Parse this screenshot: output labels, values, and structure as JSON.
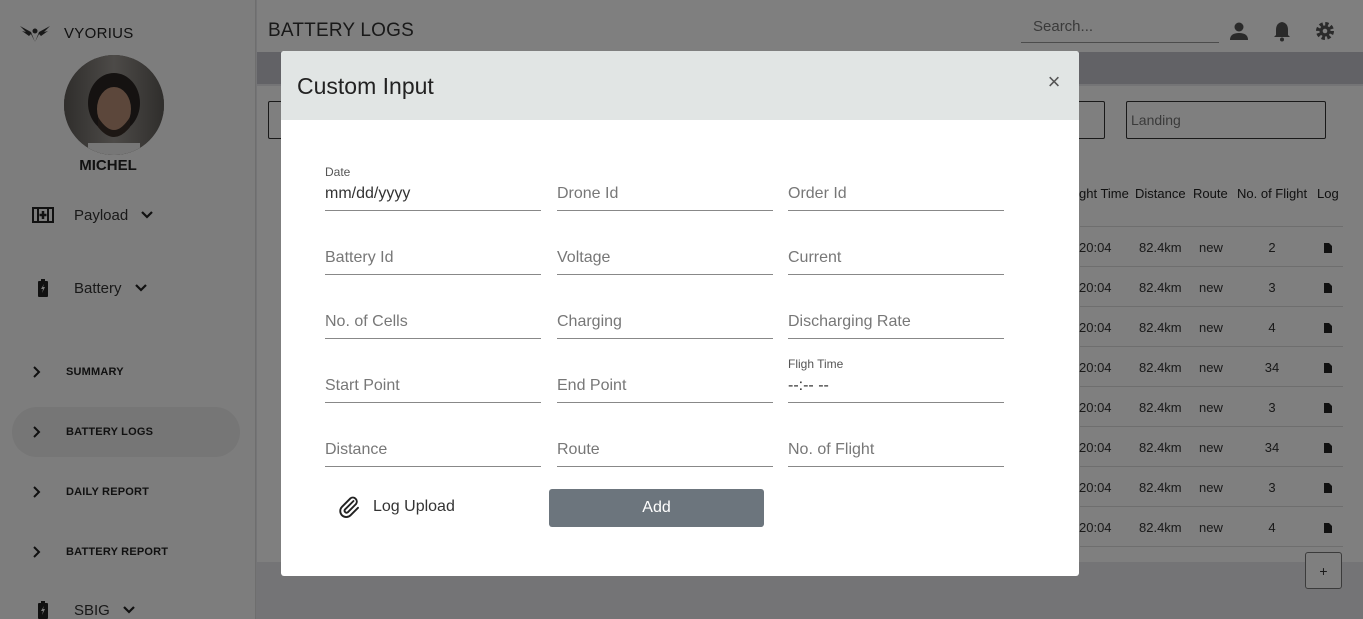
{
  "brand": {
    "name": "VYORIUS"
  },
  "user": {
    "name": "MICHEL"
  },
  "sidebar": {
    "dropdowns": [
      {
        "label": "Payload",
        "icon": "payload-icon"
      },
      {
        "label": "Battery",
        "icon": "battery-icon"
      },
      {
        "label": "SBIG",
        "icon": "battery-icon"
      }
    ],
    "nav": [
      {
        "label": "SUMMARY",
        "active": false
      },
      {
        "label": "BATTERY LOGS",
        "active": true
      },
      {
        "label": "DAILY REPORT",
        "active": false
      },
      {
        "label": "BATTERY REPORT",
        "active": false
      }
    ]
  },
  "topbar": {
    "title": "BATTERY LOGS",
    "search_placeholder": "Search..."
  },
  "filters": {
    "landing_placeholder": "Landing"
  },
  "table": {
    "headers": [
      "ght Time",
      "Distance",
      "Route",
      "No. of Flight",
      "Log"
    ],
    "rows": [
      {
        "time": "20:04",
        "distance": "82.4km",
        "route": "new",
        "flights": "2"
      },
      {
        "time": "20:04",
        "distance": "82.4km",
        "route": "new",
        "flights": "3"
      },
      {
        "time": "20:04",
        "distance": "82.4km",
        "route": "new",
        "flights": "4"
      },
      {
        "time": "20:04",
        "distance": "82.4km",
        "route": "new",
        "flights": "34"
      },
      {
        "time": "20:04",
        "distance": "82.4km",
        "route": "new",
        "flights": "3"
      },
      {
        "time": "20:04",
        "distance": "82.4km",
        "route": "new",
        "flights": "34"
      },
      {
        "time": "20:04",
        "distance": "82.4km",
        "route": "new",
        "flights": "3"
      },
      {
        "time": "20:04",
        "distance": "82.4km",
        "route": "new",
        "flights": "4"
      }
    ],
    "add_symbol": "+"
  },
  "modal": {
    "title": "Custom Input",
    "close_symbol": "×",
    "date": {
      "label": "Date",
      "value": "mm/dd/yyyy"
    },
    "flight_time": {
      "label": "Fligh Time",
      "value": "--:-- --"
    },
    "placeholders": {
      "drone_id": "Drone Id",
      "order_id": "Order Id",
      "battery_id": "Battery Id",
      "voltage": "Voltage",
      "current": "Current",
      "cells": "No. of Cells",
      "charging": "Charging",
      "discharging": "Discharging Rate",
      "start": "Start Point",
      "end": "End Point",
      "distance": "Distance",
      "route": "Route",
      "flights": "No. of Flight"
    },
    "log_upload": "Log Upload",
    "add": "Add"
  },
  "colors": {
    "add_button": "#6c757d",
    "modal_header": "#e1e5e4",
    "overlay": "rgba(0,0,0,0.5)"
  }
}
